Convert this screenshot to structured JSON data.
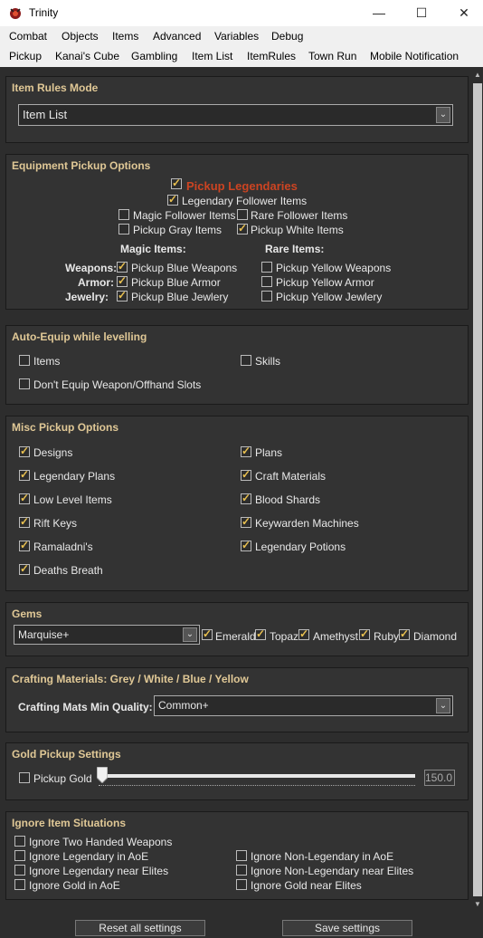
{
  "window": {
    "title": "Trinity"
  },
  "menu1": [
    "Combat",
    "Objects",
    "Items",
    "Advanced",
    "Variables",
    "Debug"
  ],
  "menu2": [
    "Pickup",
    "Kanai's Cube",
    "Gambling",
    "Item List",
    "ItemRules",
    "Town Run",
    "Mobile Notification"
  ],
  "item_rules": {
    "title": "Item Rules Mode",
    "value": "Item List"
  },
  "equip": {
    "title": "Equipment Pickup Options",
    "pickup_legendaries": "Pickup Legendaries",
    "legendary_follower": "Legendary Follower Items",
    "magic_follower": "Magic Follower Items",
    "rare_follower": "Rare Follower Items",
    "pickup_gray": "Pickup Gray Items",
    "pickup_white": "Pickup White Items",
    "magic_header": "Magic Items:",
    "rare_header": "Rare Items:",
    "weapons": "Weapons:",
    "armor": "Armor:",
    "jewelry": "Jewelry:",
    "blue_weapons": "Pickup Blue Weapons",
    "blue_armor": "Pickup Blue Armor",
    "blue_jewlery": "Pickup Blue Jewlery",
    "yellow_weapons": "Pickup Yellow Weapons",
    "yellow_armor": "Pickup Yellow Armor",
    "yellow_jewlery": "Pickup Yellow Jewlery",
    "accent": "#cc4422"
  },
  "autoequip": {
    "title": "Auto-Equip while levelling",
    "items": "Items",
    "skills": "Skills",
    "dont_equip": "Don't Equip Weapon/Offhand Slots"
  },
  "misc": {
    "title": "Misc Pickup Options",
    "left": [
      "Designs",
      "Legendary Plans",
      "Low Level Items",
      "Rift Keys",
      "Ramaladni's",
      "Deaths Breath"
    ],
    "right": [
      "Plans",
      "Craft Materials",
      "Blood Shards",
      "Keywarden Machines",
      "Legendary Potions"
    ]
  },
  "gems": {
    "title": "Gems",
    "quality": "Marquise+",
    "types": [
      "Emerald",
      "Topaz",
      "Amethyst",
      "Ruby",
      "Diamond"
    ]
  },
  "crafting": {
    "title": "Crafting Materials: Grey / White / Blue / Yellow",
    "label": "Crafting Mats Min Quality:",
    "value": "Common+"
  },
  "gold": {
    "title": "Gold Pickup Settings",
    "label": "Pickup Gold",
    "value": "150.0",
    "slider_fraction": 0.0
  },
  "ignore": {
    "title": "Ignore Item Situations",
    "left": [
      "Ignore Two Handed Weapons",
      "Ignore Legendary in AoE",
      "Ignore Legendary near Elites",
      "Ignore Gold in AoE"
    ],
    "right": [
      "Ignore Non-Legendary in AoE",
      "Ignore Non-Legendary near Elites",
      "Ignore Gold near Elites"
    ]
  },
  "footer": {
    "reset": "Reset all settings",
    "save": "Save settings"
  },
  "icons": {
    "minimize": "minimize-icon",
    "maximize": "maximize-icon",
    "close": "close-icon",
    "dropdown": "chevron-down-icon"
  }
}
